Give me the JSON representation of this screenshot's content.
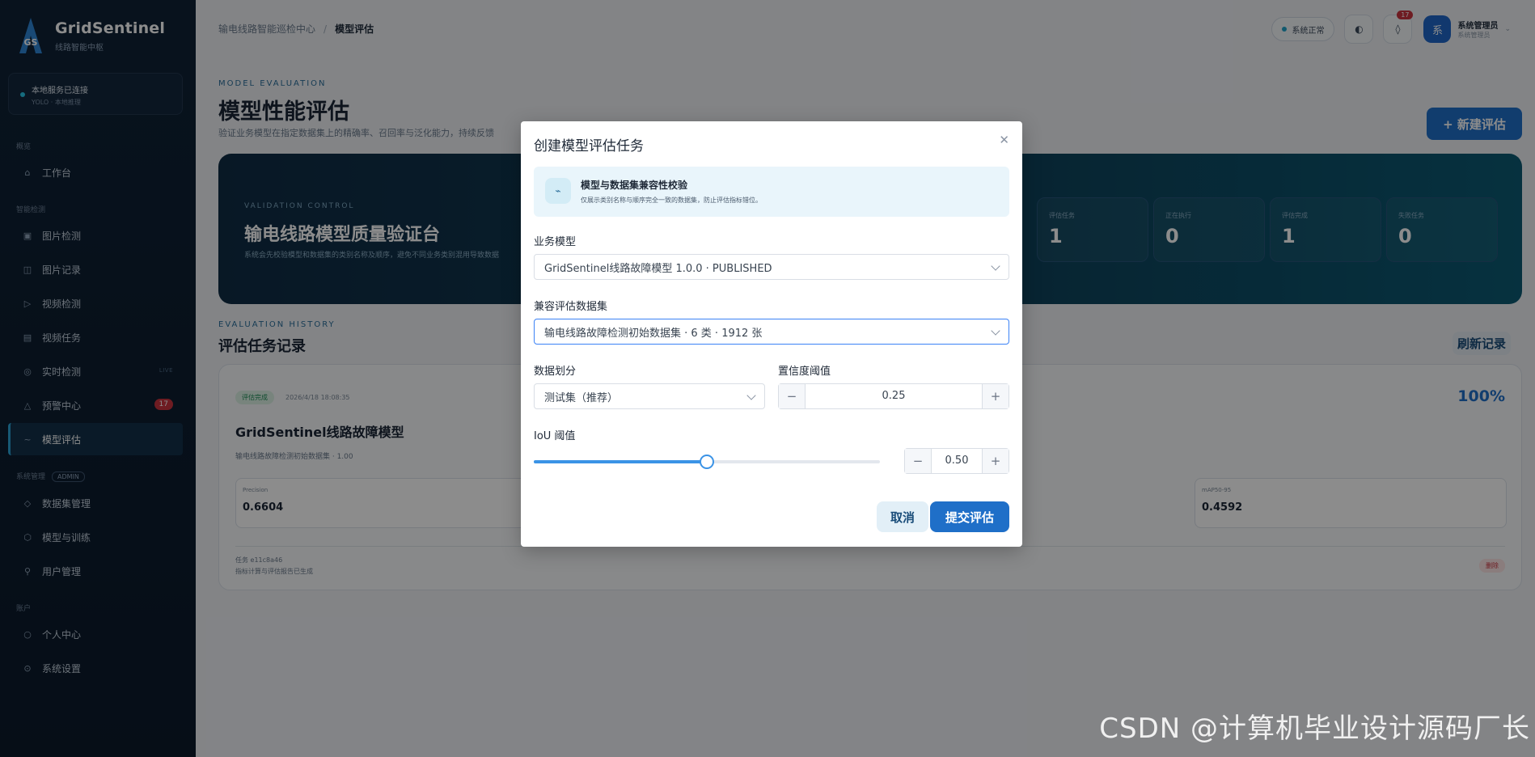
{
  "brand": {
    "name": "GridSentinel",
    "subtitle": "线路智能中枢",
    "logo_text": "GS"
  },
  "service_status": {
    "title": "本地服务已连接",
    "subtitle": "YOLO · 本地推理"
  },
  "sidebar": {
    "section_overview": "概览",
    "section_detect": "智能检测",
    "section_admin": "系统管理",
    "admin_tag": "ADMIN",
    "section_account": "账户",
    "items": [
      {
        "label": "工作台",
        "icon": "home-icon"
      },
      {
        "label": "图片检测",
        "icon": "image-icon"
      },
      {
        "label": "图片记录",
        "icon": "record-icon"
      },
      {
        "label": "视频检测",
        "icon": "play-icon"
      },
      {
        "label": "视频任务",
        "icon": "list-icon"
      },
      {
        "label": "实时检测",
        "icon": "live-icon",
        "tag": "LIVE"
      },
      {
        "label": "预警中心",
        "icon": "alert-icon",
        "badge": "17"
      },
      {
        "label": "模型评估",
        "icon": "chart-icon"
      },
      {
        "label": "数据集管理",
        "icon": "dataset-icon"
      },
      {
        "label": "模型与训练",
        "icon": "model-icon"
      },
      {
        "label": "用户管理",
        "icon": "user-icon"
      },
      {
        "label": "个人中心",
        "icon": "person-icon"
      },
      {
        "label": "系统设置",
        "icon": "settings-icon"
      }
    ]
  },
  "topbar": {
    "breadcrumb_root": "输电线路智能巡检中心",
    "breadcrumb_current": "模型评估",
    "system_status": "系统正常",
    "notification_count": "17",
    "avatar_text": "系",
    "user_name": "系统管理员",
    "user_role": "系统管理员"
  },
  "page": {
    "eyebrow": "MODEL EVALUATION",
    "title": "模型性能评估",
    "description": "验证业务模型在指定数据集上的精确率、召回率与泛化能力，持续反馈",
    "new_button": "+ 新建评估"
  },
  "hero": {
    "eyebrow": "VALIDATION CONTROL",
    "title": "输电线路模型质量验证台",
    "description": "系统会先校验模型和数据集的类别名称及顺序，避免不同业务类别混用导致数据",
    "stats": [
      {
        "label": "评估任务",
        "value": "1"
      },
      {
        "label": "正在执行",
        "value": "0"
      },
      {
        "label": "评估完成",
        "value": "1"
      },
      {
        "label": "失败任务",
        "value": "0"
      }
    ]
  },
  "history": {
    "eyebrow": "EVALUATION HISTORY",
    "title": "评估任务记录",
    "refresh": "刷新记录",
    "record": {
      "status": "评估完成",
      "time": "2026/4/18 18:08:35",
      "progress": "100%",
      "model_name": "GridSentinel线路故障模型",
      "dataset_line": "输电线路故障检测初始数据集 · 1.00",
      "metrics": [
        {
          "label": "Precision",
          "value": "0.6604"
        },
        {
          "label": "mAP50-95",
          "value": "0.4592"
        }
      ],
      "task_id": "任务 e11c8a46",
      "note": "指标计算与评估报告已生成",
      "delete": "删除"
    }
  },
  "modal": {
    "title": "创建模型评估任务",
    "info_title": "模型与数据集兼容性校验",
    "info_desc": "仅展示类别名称与顺序完全一致的数据集，防止评估指标错位。",
    "model_label": "业务模型",
    "model_value": "GridSentinel线路故障模型 1.0.0 · PUBLISHED",
    "dataset_label": "兼容评估数据集",
    "dataset_value": "输电线路故障检测初始数据集 · 6 类 · 1912 张",
    "split_label": "数据划分",
    "split_value": "测试集（推荐）",
    "conf_label": "置信度阈值",
    "conf_value": "0.25",
    "iou_label": "IoU 阈值",
    "iou_value": "0.50",
    "iou_fraction": 0.5,
    "cancel": "取消",
    "submit": "提交评估"
  },
  "watermark": "CSDN @计算机毕业设计源码厂长",
  "colors": {
    "accent": "#1f6fc8",
    "sidebar": "#0f2236",
    "danger": "#c9343f"
  }
}
